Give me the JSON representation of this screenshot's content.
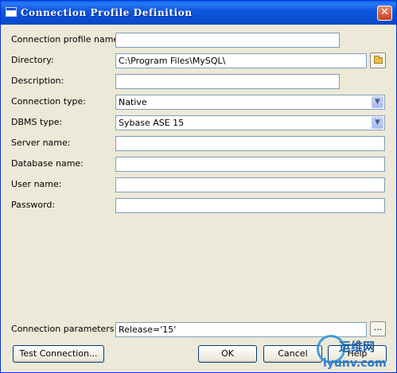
{
  "window": {
    "title": "Connection Profile Definition"
  },
  "form": {
    "fields": [
      {
        "label": "Connection profile name:",
        "value": ""
      },
      {
        "label": "Directory:",
        "value": "C:\\Program Files\\MySQL\\"
      },
      {
        "label": "Description:",
        "value": ""
      },
      {
        "label": "Connection type:",
        "value": "Native"
      },
      {
        "label": "DBMS type:",
        "value": "Sybase ASE 15"
      },
      {
        "label": "Server name:",
        "value": ""
      },
      {
        "label": "Database name:",
        "value": ""
      },
      {
        "label": "User name:",
        "value": ""
      },
      {
        "label": "Password:",
        "value": ""
      }
    ],
    "connection_parameters": {
      "label": "Connection parameters:",
      "value": "Release='15'"
    }
  },
  "buttons": {
    "test_connection": "Test Connection...",
    "ok": "OK",
    "cancel": "Cancel",
    "help": "Help",
    "browse": "...",
    "close": "✕"
  },
  "watermark": {
    "brand": "运维网",
    "url": "iyunv.com"
  }
}
